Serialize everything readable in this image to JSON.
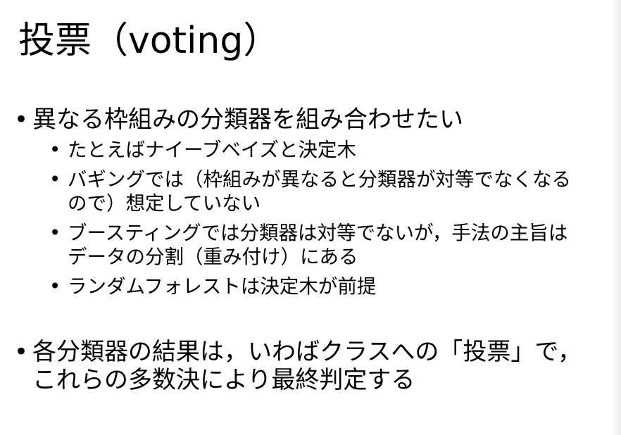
{
  "slide": {
    "title": "投票（voting）",
    "bullet_symbol": "•",
    "bullets": [
      {
        "text": "異なる枠組みの分類器を組み合わせたい",
        "sub": [
          {
            "lines": [
              "たとえばナイーブベイズと決定木"
            ]
          },
          {
            "lines": [
              "バギングでは（枠組みが異なると分類器が対等でなくなる",
              "ので）想定していない"
            ]
          },
          {
            "lines": [
              "ブースティングでは分類器は対等でないが，手法の主旨は",
              "データの分割（重み付け）にある"
            ]
          },
          {
            "lines": [
              "ランダムフォレストは決定木が前提"
            ]
          }
        ]
      },
      {
        "lines": [
          "各分類器の結果は，いわばクラスへの「投票」で，",
          "これらの多数決により最終判定する"
        ]
      }
    ]
  }
}
